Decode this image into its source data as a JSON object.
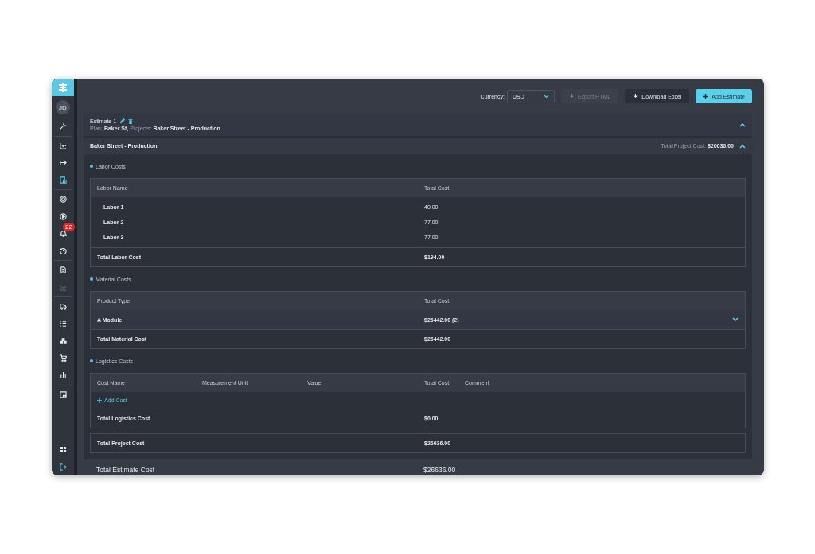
{
  "sidebar": {
    "avatar": "JD",
    "items": [
      {
        "kind": "wrench",
        "selected": false,
        "disabled": false
      },
      {
        "kind": "divider"
      },
      {
        "kind": "chart",
        "selected": false,
        "disabled": false
      },
      {
        "kind": "arrow",
        "selected": false,
        "disabled": false
      },
      {
        "kind": "document",
        "selected": true,
        "disabled": false
      },
      {
        "kind": "divider"
      },
      {
        "kind": "target",
        "selected": false,
        "disabled": false
      },
      {
        "kind": "play",
        "selected": false,
        "disabled": false
      },
      {
        "kind": "bell",
        "selected": false,
        "disabled": false,
        "badge": "22"
      },
      {
        "kind": "history",
        "selected": false,
        "disabled": false
      },
      {
        "kind": "divider"
      },
      {
        "kind": "file",
        "selected": false,
        "disabled": false
      },
      {
        "kind": "chart",
        "selected": false,
        "disabled": true
      },
      {
        "kind": "divider"
      },
      {
        "kind": "truck",
        "selected": false,
        "disabled": false
      },
      {
        "kind": "list",
        "selected": false,
        "disabled": false
      },
      {
        "kind": "boxes",
        "selected": false,
        "disabled": false
      },
      {
        "kind": "cart",
        "selected": false,
        "disabled": false
      },
      {
        "kind": "bars",
        "selected": false,
        "disabled": false
      },
      {
        "kind": "divider"
      },
      {
        "kind": "window",
        "selected": false,
        "disabled": false
      },
      {
        "kind": "spacer"
      },
      {
        "kind": "grid",
        "selected": false,
        "disabled": false
      },
      {
        "kind": "logout",
        "selected": true,
        "disabled": false
      }
    ]
  },
  "toolbar": {
    "currency_label": "Currency:",
    "currency": "USD",
    "buttons": [
      {
        "label": "Export HTML",
        "kind": "download",
        "primary": false,
        "disabled": true
      },
      {
        "label": "Download Excel",
        "kind": "download",
        "primary": false,
        "disabled": false
      },
      {
        "label": "Add Estimate",
        "kind": "plus",
        "primary": true,
        "disabled": false
      }
    ]
  },
  "estimate": {
    "title": "Estimate 1",
    "plan_label": "Plan:",
    "plan": "Baker St,",
    "projects_label": "Projects:",
    "projects": "Baker Street - Production",
    "expanded": true
  },
  "project": {
    "title": "Baker Street - Production",
    "total_label": "Total Project Cost:",
    "total": "$26636.00",
    "expanded": true
  },
  "labor": {
    "title": "Labor Costs",
    "columns": [
      "Labor Name",
      "Total Cost"
    ],
    "rows": [
      [
        "Labor 1",
        "40.00"
      ],
      [
        "Labor 2",
        "77.00"
      ],
      [
        "Labor 3",
        "77.00"
      ]
    ],
    "total_label": "Total Labor Cost",
    "total": "$194.00"
  },
  "material": {
    "title": "Material Costs",
    "columns": [
      "Product Type",
      "Total Cost"
    ],
    "rows": [
      {
        "name": "A Module",
        "total": "$26442.00 (2)",
        "expanded": false
      }
    ],
    "total_label": "Total Material Cost",
    "total": "$26442.00"
  },
  "logistics": {
    "title": "Logistics Costs",
    "columns": [
      "Cost Name",
      "Measurement Unit",
      "Value",
      "Total Cost",
      "Comment"
    ],
    "add_label": "Add Cost",
    "total_label": "Total Logistics Cost",
    "total": "$0.00"
  },
  "project_total": {
    "label": "Total Project Cost",
    "value": "$26636.00"
  },
  "estimate_total": {
    "label": "Total Estimate Cost",
    "value": "$26636.00"
  }
}
